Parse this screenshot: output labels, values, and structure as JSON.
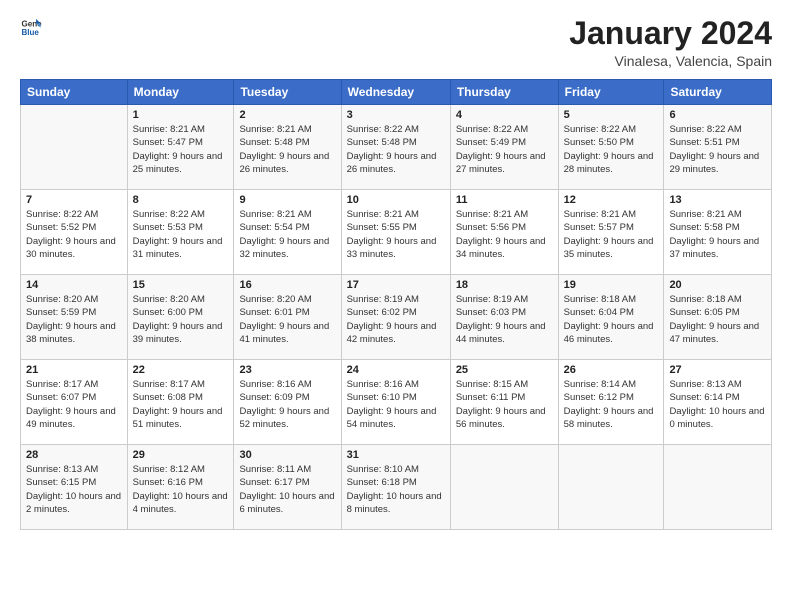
{
  "header": {
    "logo_general": "General",
    "logo_blue": "Blue",
    "title": "January 2024",
    "subtitle": "Vinalesa, Valencia, Spain"
  },
  "days_of_week": [
    "Sunday",
    "Monday",
    "Tuesday",
    "Wednesday",
    "Thursday",
    "Friday",
    "Saturday"
  ],
  "weeks": [
    [
      {
        "day": "",
        "sunrise": "",
        "sunset": "",
        "daylight": ""
      },
      {
        "day": "1",
        "sunrise": "Sunrise: 8:21 AM",
        "sunset": "Sunset: 5:47 PM",
        "daylight": "Daylight: 9 hours and 25 minutes."
      },
      {
        "day": "2",
        "sunrise": "Sunrise: 8:21 AM",
        "sunset": "Sunset: 5:48 PM",
        "daylight": "Daylight: 9 hours and 26 minutes."
      },
      {
        "day": "3",
        "sunrise": "Sunrise: 8:22 AM",
        "sunset": "Sunset: 5:48 PM",
        "daylight": "Daylight: 9 hours and 26 minutes."
      },
      {
        "day": "4",
        "sunrise": "Sunrise: 8:22 AM",
        "sunset": "Sunset: 5:49 PM",
        "daylight": "Daylight: 9 hours and 27 minutes."
      },
      {
        "day": "5",
        "sunrise": "Sunrise: 8:22 AM",
        "sunset": "Sunset: 5:50 PM",
        "daylight": "Daylight: 9 hours and 28 minutes."
      },
      {
        "day": "6",
        "sunrise": "Sunrise: 8:22 AM",
        "sunset": "Sunset: 5:51 PM",
        "daylight": "Daylight: 9 hours and 29 minutes."
      }
    ],
    [
      {
        "day": "7",
        "sunrise": "Sunrise: 8:22 AM",
        "sunset": "Sunset: 5:52 PM",
        "daylight": "Daylight: 9 hours and 30 minutes."
      },
      {
        "day": "8",
        "sunrise": "Sunrise: 8:22 AM",
        "sunset": "Sunset: 5:53 PM",
        "daylight": "Daylight: 9 hours and 31 minutes."
      },
      {
        "day": "9",
        "sunrise": "Sunrise: 8:21 AM",
        "sunset": "Sunset: 5:54 PM",
        "daylight": "Daylight: 9 hours and 32 minutes."
      },
      {
        "day": "10",
        "sunrise": "Sunrise: 8:21 AM",
        "sunset": "Sunset: 5:55 PM",
        "daylight": "Daylight: 9 hours and 33 minutes."
      },
      {
        "day": "11",
        "sunrise": "Sunrise: 8:21 AM",
        "sunset": "Sunset: 5:56 PM",
        "daylight": "Daylight: 9 hours and 34 minutes."
      },
      {
        "day": "12",
        "sunrise": "Sunrise: 8:21 AM",
        "sunset": "Sunset: 5:57 PM",
        "daylight": "Daylight: 9 hours and 35 minutes."
      },
      {
        "day": "13",
        "sunrise": "Sunrise: 8:21 AM",
        "sunset": "Sunset: 5:58 PM",
        "daylight": "Daylight: 9 hours and 37 minutes."
      }
    ],
    [
      {
        "day": "14",
        "sunrise": "Sunrise: 8:20 AM",
        "sunset": "Sunset: 5:59 PM",
        "daylight": "Daylight: 9 hours and 38 minutes."
      },
      {
        "day": "15",
        "sunrise": "Sunrise: 8:20 AM",
        "sunset": "Sunset: 6:00 PM",
        "daylight": "Daylight: 9 hours and 39 minutes."
      },
      {
        "day": "16",
        "sunrise": "Sunrise: 8:20 AM",
        "sunset": "Sunset: 6:01 PM",
        "daylight": "Daylight: 9 hours and 41 minutes."
      },
      {
        "day": "17",
        "sunrise": "Sunrise: 8:19 AM",
        "sunset": "Sunset: 6:02 PM",
        "daylight": "Daylight: 9 hours and 42 minutes."
      },
      {
        "day": "18",
        "sunrise": "Sunrise: 8:19 AM",
        "sunset": "Sunset: 6:03 PM",
        "daylight": "Daylight: 9 hours and 44 minutes."
      },
      {
        "day": "19",
        "sunrise": "Sunrise: 8:18 AM",
        "sunset": "Sunset: 6:04 PM",
        "daylight": "Daylight: 9 hours and 46 minutes."
      },
      {
        "day": "20",
        "sunrise": "Sunrise: 8:18 AM",
        "sunset": "Sunset: 6:05 PM",
        "daylight": "Daylight: 9 hours and 47 minutes."
      }
    ],
    [
      {
        "day": "21",
        "sunrise": "Sunrise: 8:17 AM",
        "sunset": "Sunset: 6:07 PM",
        "daylight": "Daylight: 9 hours and 49 minutes."
      },
      {
        "day": "22",
        "sunrise": "Sunrise: 8:17 AM",
        "sunset": "Sunset: 6:08 PM",
        "daylight": "Daylight: 9 hours and 51 minutes."
      },
      {
        "day": "23",
        "sunrise": "Sunrise: 8:16 AM",
        "sunset": "Sunset: 6:09 PM",
        "daylight": "Daylight: 9 hours and 52 minutes."
      },
      {
        "day": "24",
        "sunrise": "Sunrise: 8:16 AM",
        "sunset": "Sunset: 6:10 PM",
        "daylight": "Daylight: 9 hours and 54 minutes."
      },
      {
        "day": "25",
        "sunrise": "Sunrise: 8:15 AM",
        "sunset": "Sunset: 6:11 PM",
        "daylight": "Daylight: 9 hours and 56 minutes."
      },
      {
        "day": "26",
        "sunrise": "Sunrise: 8:14 AM",
        "sunset": "Sunset: 6:12 PM",
        "daylight": "Daylight: 9 hours and 58 minutes."
      },
      {
        "day": "27",
        "sunrise": "Sunrise: 8:13 AM",
        "sunset": "Sunset: 6:14 PM",
        "daylight": "Daylight: 10 hours and 0 minutes."
      }
    ],
    [
      {
        "day": "28",
        "sunrise": "Sunrise: 8:13 AM",
        "sunset": "Sunset: 6:15 PM",
        "daylight": "Daylight: 10 hours and 2 minutes."
      },
      {
        "day": "29",
        "sunrise": "Sunrise: 8:12 AM",
        "sunset": "Sunset: 6:16 PM",
        "daylight": "Daylight: 10 hours and 4 minutes."
      },
      {
        "day": "30",
        "sunrise": "Sunrise: 8:11 AM",
        "sunset": "Sunset: 6:17 PM",
        "daylight": "Daylight: 10 hours and 6 minutes."
      },
      {
        "day": "31",
        "sunrise": "Sunrise: 8:10 AM",
        "sunset": "Sunset: 6:18 PM",
        "daylight": "Daylight: 10 hours and 8 minutes."
      },
      {
        "day": "",
        "sunrise": "",
        "sunset": "",
        "daylight": ""
      },
      {
        "day": "",
        "sunrise": "",
        "sunset": "",
        "daylight": ""
      },
      {
        "day": "",
        "sunrise": "",
        "sunset": "",
        "daylight": ""
      }
    ]
  ]
}
